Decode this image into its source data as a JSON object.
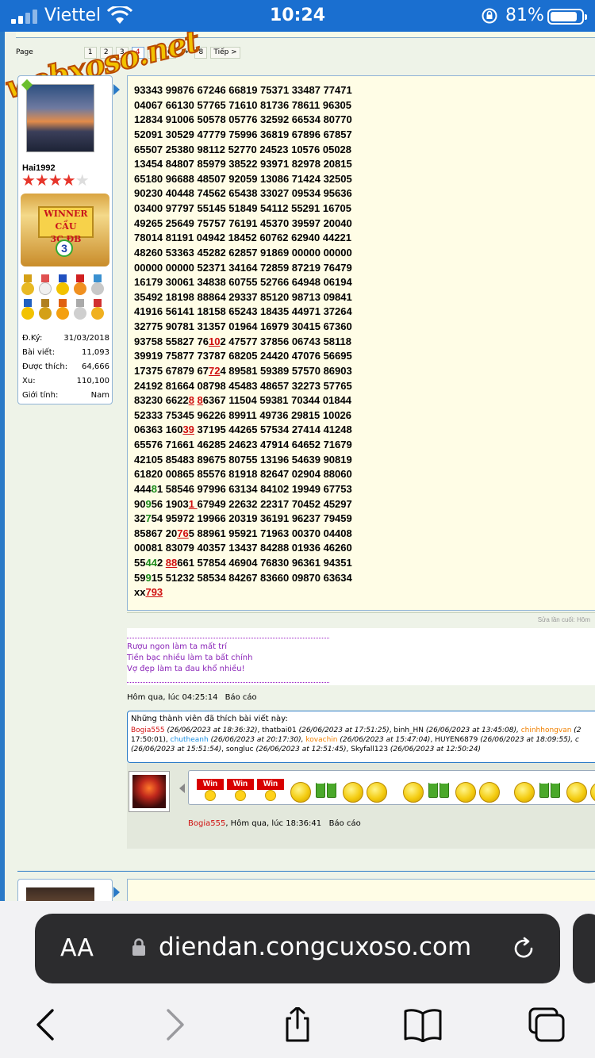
{
  "status_bar": {
    "carrier": "Viettel",
    "time": "10:24",
    "battery": "81%"
  },
  "watermark": "webxoso.net",
  "pagination": {
    "label": "Page",
    "pages": [
      "1",
      "2",
      "3",
      "4",
      "5",
      "6"
    ],
    "current": "4",
    "arrow": "→",
    "last": "8",
    "next": "Tiếp >"
  },
  "user": {
    "name": "Hai1992",
    "stars_on": "★★★★",
    "stars_off": "★",
    "award_line1": "WINNER",
    "award_line2": "CẦU 3C.ĐB",
    "award_number": "3",
    "stats": [
      {
        "k": "Đ.Ký:",
        "v": "31/03/2018"
      },
      {
        "k": "Bài viết:",
        "v": "11,093"
      },
      {
        "k": "Được thích:",
        "v": "64,666"
      },
      {
        "k": "Xu:",
        "v": "110,100"
      },
      {
        "k": "Giới tính:",
        "v": "Nam"
      }
    ]
  },
  "numbers": [
    "93343 99876 67246 66819 75371 33487 77471",
    "04067 66130 57765 71610 81736 78611 96305",
    "12834 91006 50578 05776 32592 66534 80770",
    "52091 30529 47779 75996 36819 67896 67857",
    "65507 25380 98112 52770 24523 10576 05028",
    "13454 84807 85979 38522 93971 82978 20815",
    "65180 96688 48507 92059 13086 71424 32505",
    "90230 40448 74562 65438 33027 09534 95636",
    "03400 97797 55145 51849 54112 55291 16705",
    "49265 25649 75757 76191 45370 39597 20040",
    "78014 81191 04942 18452 60762 62940 44221",
    "48260 53363 45282 62857 91869 00000 00000",
    "00000 00000 52371 34164 72859 87219 76479",
    "16179 30061 34838 60755 52766 64948 06194",
    "35492 18198 88864 29337 85120 98713 09841",
    "41916 56141 18158 65243 18435 44971 37264",
    "32775 90781 31357 01964 16979 30415 67360",
    "93758 55827 76102 47577 37856 06743 58118",
    "39919 75877 73787 68205 24420 47076 56695",
    "17375 67879 67724 89581 59389 57570 86903",
    "24192 81664 08798 45483 48657 32273 57765",
    "83230 66228 86367 11504 59381 70344 01844",
    "52333 75345 96226 89911 49736 29815 10026",
    "06363 16039 37195 44265 57534 27414 41248",
    "65576 71661 46285 24623 47914 64652 71679",
    "42105 85483 89675 80755 13196 54639 90819",
    "61820 00865 85576 81918 82647 02904 88060",
    "44481 58546 97996 63134 84102 19949 67753",
    "90956 19031 67949 22632 22317 70452 45297",
    "32754 95972 19966 20319 36191 96237 79459",
    "85867 20765 88961 95921 71963 00370 04408",
    "00081 83079 40357 13437 84288 01936 46260",
    "55442 88661 57854 46904 76830 96361 94351",
    "59915 51232 58534 84267 83660 09870 63634",
    "xx793"
  ],
  "edit_note": "Sửa lần cuối: Hôm",
  "signature": [
    "Rượu ngon làm ta mất trí",
    "Tiền bạc nhiều làm ta bất chính",
    "Vợ đẹp làm ta đau khổ nhiều!"
  ],
  "post_meta": {
    "time": "Hôm qua, lúc 04:25:14",
    "report": "Báo cáo"
  },
  "likes": {
    "title": "Những thành viên đã thích bài viết này:",
    "line1": [
      {
        "u": "Bogia555",
        "c": "red",
        "t": " (26/06/2023 at 18:36:32)"
      },
      {
        "u": ", thatbai01",
        "c": "plain",
        "t": " (26/06/2023 at 17:51:25)"
      },
      {
        "u": ", binh_HN",
        "c": "plain",
        "t": " (26/06/2023 at 13:45:08), "
      },
      {
        "u": "chinhhongvan",
        "c": "orange",
        "t": " (2"
      }
    ],
    "line2": [
      {
        "u": "17:50:01), ",
        "c": "plain",
        "t": ""
      },
      {
        "u": "chutheanh",
        "c": "blue",
        "t": " (26/06/2023 at 20:17:30), "
      },
      {
        "u": "kovachin",
        "c": "orange",
        "t": " (26/06/2023 at 15:47:04)"
      },
      {
        "u": ", HUYEN6879",
        "c": "plain",
        "t": " (26/06/2023 at 18:09:55), c"
      }
    ],
    "line3": [
      {
        "u": "",
        "c": "plain",
        "t": "(26/06/2023 at 15:51:54)"
      },
      {
        "u": ", songluc",
        "c": "plain",
        "t": " (26/06/2023 at 12:51:45)"
      },
      {
        "u": ", Skyfall123",
        "c": "plain",
        "t": " (26/06/2023 at 12:50:24)"
      }
    ]
  },
  "reply": {
    "win_label": "Win",
    "author": "Bogia555",
    "time": ", Hôm qua, lúc 18:36:41",
    "report": "Báo cáo"
  },
  "browser": {
    "text_size": "AA",
    "url": "diendan.congcuxoso.com"
  },
  "colors": {
    "accent_blue": "#2a7ac7",
    "highlight_red": "#d01010",
    "highlight_green": "#1a8a1a",
    "signature_purple": "#8a24b8"
  }
}
